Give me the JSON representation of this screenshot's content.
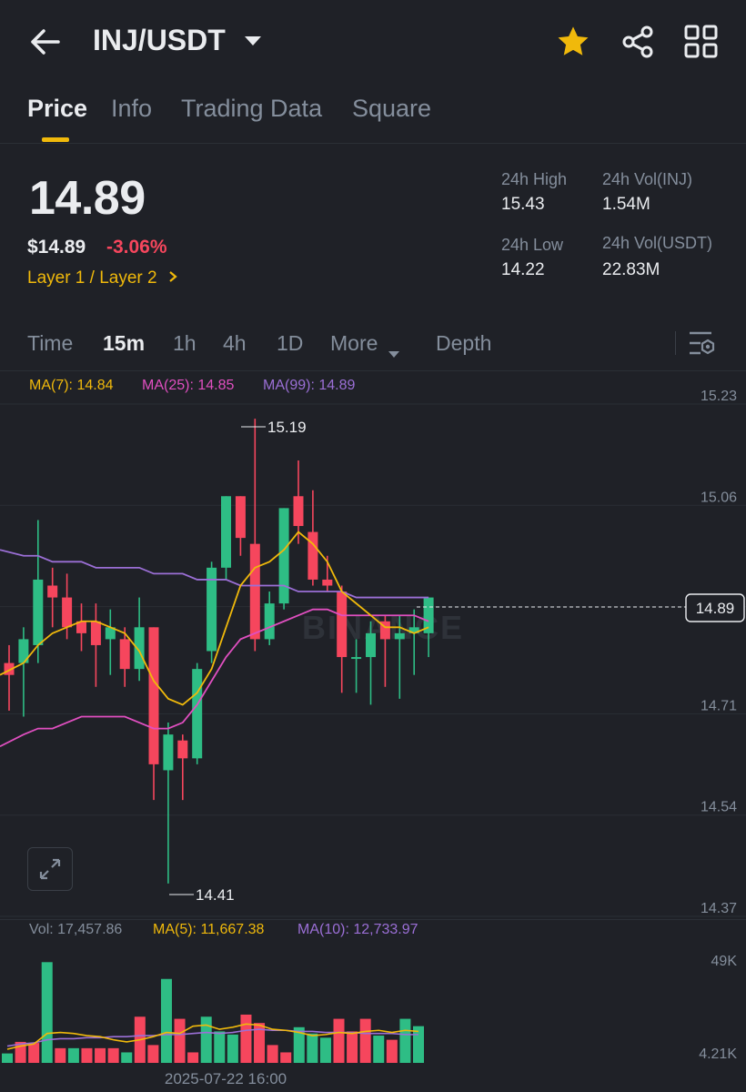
{
  "header": {
    "pair": "INJ/USDT",
    "icons": [
      "back-arrow-icon",
      "chevron-down-icon",
      "star-icon",
      "share-icon",
      "grid-icon"
    ],
    "star_color": "#f0b90b"
  },
  "tabs": [
    {
      "label": "Price",
      "active": true
    },
    {
      "label": "Info",
      "active": false
    },
    {
      "label": "Trading Data",
      "active": false
    },
    {
      "label": "Square",
      "active": false
    }
  ],
  "ticker": {
    "last_price": "14.89",
    "usd_price": "$14.89",
    "change": "-3.06%",
    "sector": "Layer 1 / Layer 2",
    "high_label": "24h High",
    "high": "15.43",
    "low_label": "24h Low",
    "low": "14.22",
    "vol_base_label": "24h Vol(INJ)",
    "vol_base": "1.54M",
    "vol_quote_label": "24h Vol(USDT)",
    "vol_quote": "22.83M"
  },
  "timeframes": {
    "items": [
      "Time",
      "15m",
      "1h",
      "4h",
      "1D"
    ],
    "active": "15m",
    "more": "More",
    "depth": "Depth"
  },
  "ma_legend": {
    "ma7": "MA(7): 14.84",
    "ma25": "MA(25): 14.85",
    "ma99": "MA(99): 14.89"
  },
  "vol_legend": {
    "vol": "Vol: 17,457.86",
    "ma5": "MA(5): 11,667.38",
    "ma10": "MA(10): 12,733.97"
  },
  "colors": {
    "up": "#2ebd85",
    "down": "#f6465d",
    "ma7": "#f0b90b",
    "ma25": "#e04fc0",
    "ma99": "#9b6fd6",
    "accent": "#f0b90b"
  },
  "chart_data": {
    "type": "candlestick",
    "price_axis_ticks": [
      "15.23",
      "15.06",
      "14.89",
      "14.71",
      "14.54",
      "14.37"
    ],
    "last_price_tag": "14.89",
    "high_annotation": "15.19",
    "low_annotation": "14.41",
    "volume_axis_ticks": [
      "49K",
      "4.21K"
    ],
    "x_label": "2025-07-22 16:00",
    "watermark": "BINANCE",
    "candles": [
      {
        "o": 14.78,
        "h": 14.81,
        "l": 14.7,
        "c": 14.76
      },
      {
        "o": 14.78,
        "h": 14.84,
        "l": 14.69,
        "c": 14.82
      },
      {
        "o": 14.81,
        "h": 15.02,
        "l": 14.78,
        "c": 14.92
      },
      {
        "o": 14.91,
        "h": 14.94,
        "l": 14.84,
        "c": 14.89
      },
      {
        "o": 14.89,
        "h": 14.93,
        "l": 14.82,
        "c": 14.84
      },
      {
        "o": 14.85,
        "h": 14.88,
        "l": 14.8,
        "c": 14.83
      },
      {
        "o": 14.85,
        "h": 14.88,
        "l": 14.74,
        "c": 14.81
      },
      {
        "o": 14.82,
        "h": 14.87,
        "l": 14.76,
        "c": 14.84
      },
      {
        "o": 14.82,
        "h": 14.84,
        "l": 14.74,
        "c": 14.77
      },
      {
        "o": 14.77,
        "h": 14.89,
        "l": 14.75,
        "c": 14.84
      },
      {
        "o": 14.84,
        "h": 14.84,
        "l": 14.55,
        "c": 14.61
      },
      {
        "o": 14.6,
        "h": 14.68,
        "l": 14.41,
        "c": 14.66
      },
      {
        "o": 14.65,
        "h": 14.66,
        "l": 14.55,
        "c": 14.62
      },
      {
        "o": 14.62,
        "h": 14.78,
        "l": 14.61,
        "c": 14.77
      },
      {
        "o": 14.8,
        "h": 14.95,
        "l": 14.78,
        "c": 14.94
      },
      {
        "o": 14.94,
        "h": 15.06,
        "l": 14.92,
        "c": 15.06
      },
      {
        "o": 15.06,
        "h": 15.06,
        "l": 14.96,
        "c": 14.99
      },
      {
        "o": 14.98,
        "h": 15.19,
        "l": 14.8,
        "c": 14.82
      },
      {
        "o": 14.82,
        "h": 14.9,
        "l": 14.81,
        "c": 14.88
      },
      {
        "o": 14.88,
        "h": 15.04,
        "l": 14.87,
        "c": 15.04
      },
      {
        "o": 15.06,
        "h": 15.12,
        "l": 14.98,
        "c": 15.01
      },
      {
        "o": 15.0,
        "h": 15.07,
        "l": 14.91,
        "c": 14.92
      },
      {
        "o": 14.92,
        "h": 14.96,
        "l": 14.9,
        "c": 14.91
      },
      {
        "o": 14.9,
        "h": 14.91,
        "l": 14.73,
        "c": 14.79
      },
      {
        "o": 14.79,
        "h": 14.82,
        "l": 14.73,
        "c": 14.79
      },
      {
        "o": 14.79,
        "h": 14.85,
        "l": 14.71,
        "c": 14.83
      },
      {
        "o": 14.85,
        "h": 14.86,
        "l": 14.74,
        "c": 14.82
      },
      {
        "o": 14.82,
        "h": 14.86,
        "l": 14.72,
        "c": 14.83
      },
      {
        "o": 14.83,
        "h": 14.87,
        "l": 14.76,
        "c": 14.84
      },
      {
        "o": 14.83,
        "h": 14.89,
        "l": 14.79,
        "c": 14.89
      }
    ],
    "ma7": [
      14.76,
      14.78,
      14.81,
      14.83,
      14.84,
      14.85,
      14.85,
      14.84,
      14.83,
      14.8,
      14.75,
      14.72,
      14.71,
      14.73,
      14.77,
      14.84,
      14.91,
      14.94,
      14.95,
      14.97,
      15.0,
      14.98,
      14.95,
      14.9,
      14.88,
      14.86,
      14.84,
      14.84,
      14.83,
      14.84
    ],
    "ma25": [
      14.64,
      14.66,
      14.67,
      14.67,
      14.68,
      14.69,
      14.69,
      14.69,
      14.69,
      14.68,
      14.67,
      14.67,
      14.68,
      14.71,
      14.75,
      14.79,
      14.82,
      14.83,
      14.84,
      14.85,
      14.86,
      14.87,
      14.87,
      14.86,
      14.86,
      14.86,
      14.86,
      14.86,
      14.86,
      14.85
    ],
    "ma99": [
      14.97,
      14.96,
      14.96,
      14.95,
      14.95,
      14.95,
      14.94,
      14.94,
      14.94,
      14.94,
      14.93,
      14.93,
      14.93,
      14.92,
      14.92,
      14.92,
      14.91,
      14.91,
      14.91,
      14.91,
      14.9,
      14.9,
      14.9,
      14.9,
      14.89,
      14.89,
      14.89,
      14.89,
      14.89,
      14.89
    ],
    "volumes": [
      4500,
      10000,
      9500,
      48000,
      7000,
      7000,
      7000,
      7000,
      7000,
      5000,
      22000,
      8500,
      40000,
      21000,
      5000,
      22000,
      15000,
      13500,
      23000,
      19000,
      8500,
      5000,
      17000,
      14000,
      12000,
      21000,
      15000,
      21000,
      13000,
      11000,
      21000,
      17500
    ],
    "vol_ma5": [
      6500,
      8000,
      9000,
      14000,
      14500,
      14000,
      13000,
      12500,
      11000,
      10000,
      11000,
      12500,
      14500,
      14000,
      17500,
      18000,
      16000,
      17000,
      18500,
      18000,
      16000,
      15500,
      14500,
      13000,
      13500,
      14500,
      14000,
      15000,
      15500,
      14500,
      15500,
      15000
    ],
    "vol_ma10": [
      8000,
      9000,
      9500,
      11000,
      11500,
      11500,
      12000,
      12000,
      12500,
      12500,
      13000,
      13000,
      13500,
      13500,
      14000,
      14500,
      14000,
      14500,
      15500,
      16000,
      15500,
      15500,
      15000,
      15000,
      14500,
      14500,
      14500,
      14000,
      14000,
      14000,
      13500,
      13500
    ]
  }
}
